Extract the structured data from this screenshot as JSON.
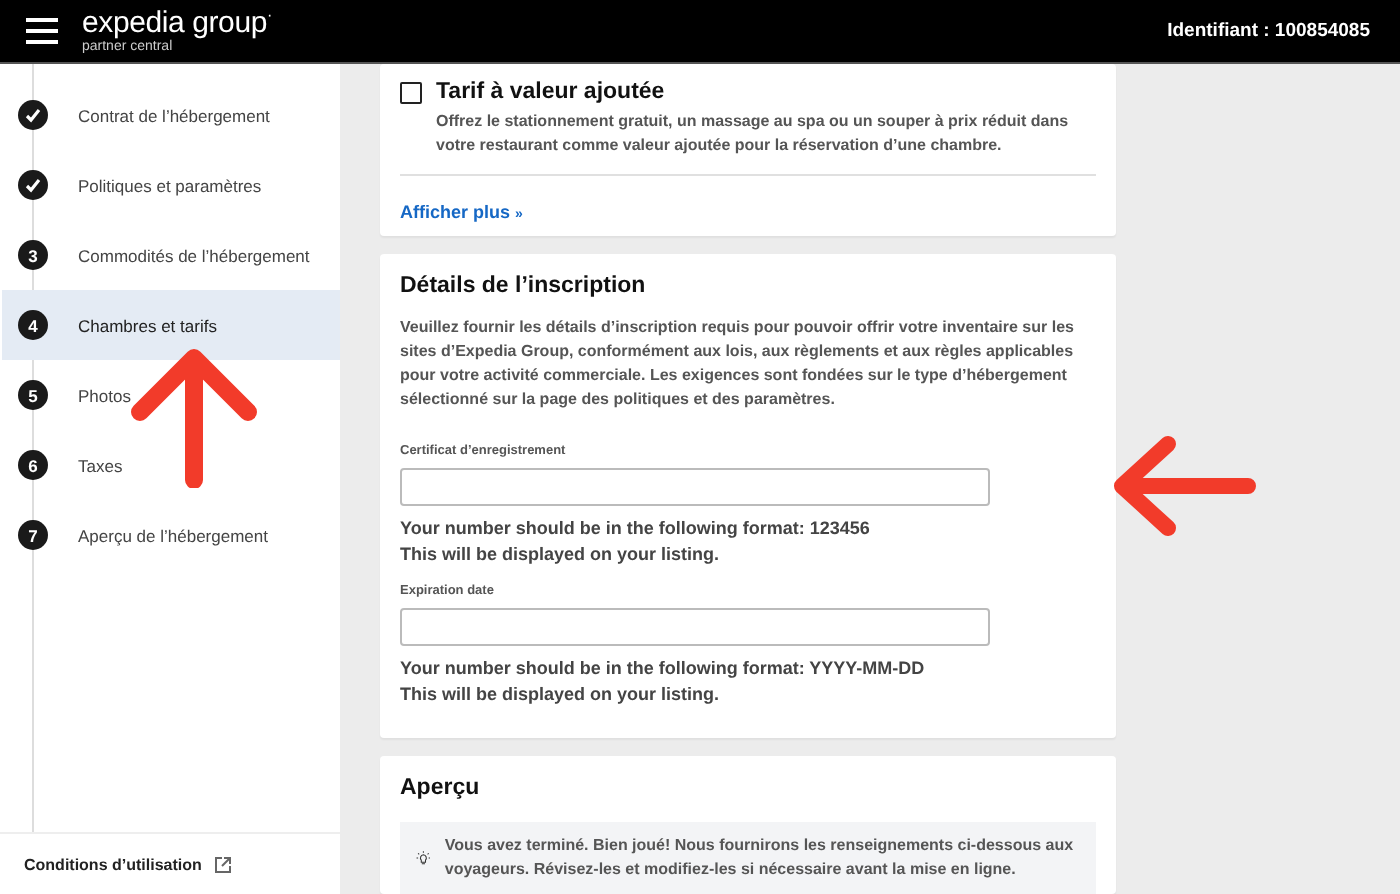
{
  "header": {
    "logo": "expedia group",
    "logo_mark": "·",
    "subtitle": "partner central",
    "account_id": "Identifiant : 100854085"
  },
  "steps": [
    {
      "label": "Contrat de l’hébergement",
      "completed": true,
      "selected": false
    },
    {
      "label": "Politiques et paramètres",
      "completed": true,
      "selected": false
    },
    {
      "number": "3",
      "label": "Commodités de l’hébergement",
      "completed": false,
      "selected": false
    },
    {
      "number": "4",
      "label": "Chambres et tarifs",
      "completed": false,
      "selected": true
    },
    {
      "number": "5",
      "label": "Photos",
      "completed": false,
      "selected": false
    },
    {
      "number": "6",
      "label": "Taxes",
      "completed": false,
      "selected": false
    },
    {
      "number": "7",
      "label": "Aperçu de l’hébergement",
      "completed": false,
      "selected": false
    }
  ],
  "terms_link": "Conditions d’utilisation",
  "value_add": {
    "title": "Tarif à valeur ajoutée",
    "checked": false,
    "description": "Offrez le stationnement gratuit, un massage au spa ou un souper à prix réduit dans votre restaurant comme valeur ajoutée pour la réservation d’une chambre.",
    "show_more": "Afficher plus",
    "show_more_icon": "»"
  },
  "registration": {
    "title": "Détails de l’inscription",
    "description": "Veuillez fournir les détails d’inscription requis pour pouvoir offrir votre inventaire sur les sites d’Expedia Group, conformément aux lois, aux règlements et aux règles applicables pour votre activité commerciale. Les exigences sont fondées sur le type d’hébergement sélectionné sur la page des politiques et des paramètres.",
    "fields": [
      {
        "label": "Certificat d’enregistrement",
        "hints": [
          "Your number should be in the following format: 123456",
          "This will be displayed on your listing."
        ]
      },
      {
        "label": "Expiration date",
        "hints": [
          "Your number should be in the following format: YYYY-MM-DD",
          "This will be displayed on your listing."
        ]
      }
    ]
  },
  "preview": {
    "title": "Aperçu",
    "tip": "Vous avez terminé. Bien joué! Nous fournirons les renseignements ci-dessous aux voyageurs. Révisez-les et modifiez-les si nécessaire avant la mise en ligne."
  }
}
